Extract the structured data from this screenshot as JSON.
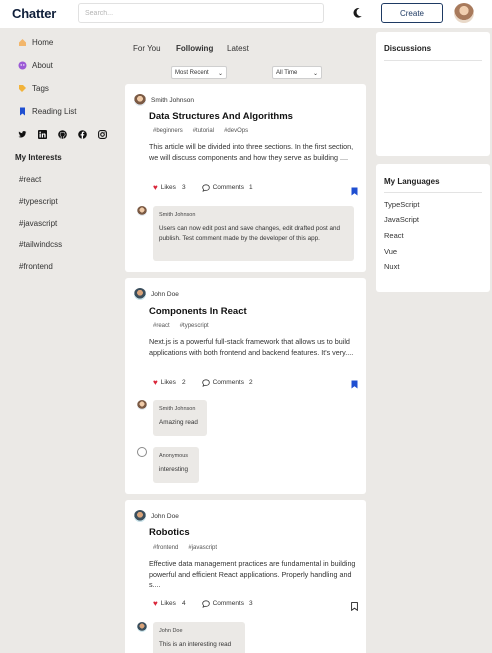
{
  "app": {
    "logo": "Chatter"
  },
  "header": {
    "search_placeholder": "Search...",
    "create_label": "Create",
    "theme_icon": "moon-icon"
  },
  "sidebar": {
    "nav": [
      {
        "label": "Home",
        "icon": "home-icon"
      },
      {
        "label": "About",
        "icon": "about-icon"
      },
      {
        "label": "Tags",
        "icon": "tag-icon"
      },
      {
        "label": "Reading List",
        "icon": "bookmark-icon"
      }
    ],
    "socials": [
      "twitter-icon",
      "linkedin-icon",
      "github-icon",
      "facebook-icon",
      "instagram-icon"
    ],
    "interests_title": "My Interests",
    "interests": [
      "#react",
      "#typescript",
      "#javascript",
      "#tailwindcss",
      "#frontend"
    ]
  },
  "feed": {
    "tabs": [
      {
        "label": "For You"
      },
      {
        "label": "Following",
        "active": true
      },
      {
        "label": "Latest"
      }
    ],
    "sort_value": "Most Recent",
    "time_value": "All Time",
    "posts": [
      {
        "author": "Smith Johnson",
        "title": "Data Structures And Algorithms",
        "tags": [
          "#beginners",
          "#tutorial",
          "#devOps"
        ],
        "excerpt": "This article will be divided into three sections. In the first section, we will discuss components and how they serve as building ....",
        "likes_label": "Likes",
        "likes": "3",
        "comments_label": "Comments",
        "comments": "1",
        "bookmarked": true,
        "comment_list": [
          {
            "name": "Smith Johnson",
            "text": "Users can now edit post and save changes, edit drafted post and publish. Test comment made by the developer of this app."
          }
        ]
      },
      {
        "author": "John Doe",
        "title": "Components In React",
        "tags": [
          "#react",
          "#typescript"
        ],
        "excerpt": "Next.js is a powerful full-stack framework that allows us to build applications with both frontend and backend features. It's very....",
        "likes_label": "Likes",
        "likes": "2",
        "comments_label": "Comments",
        "comments": "2",
        "bookmarked": true,
        "comment_list": [
          {
            "name": "Smith Johnson",
            "text": "Amazing read"
          },
          {
            "name": "Anonymous",
            "text": "interesting"
          }
        ]
      },
      {
        "author": "John Doe",
        "title": "Robotics",
        "tags": [
          "#frontend",
          "#javascript"
        ],
        "excerpt": "Effective data management practices are fundamental in building powerful and efficient React applications. Properly handling and s....",
        "likes_label": "Likes",
        "likes": "4",
        "comments_label": "Comments",
        "comments": "3",
        "bookmarked": false,
        "comment_list": [
          {
            "name": "John Doe",
            "text": "This is an interesting read"
          }
        ]
      }
    ]
  },
  "right": {
    "discussions_title": "Discussions",
    "languages_title": "My Languages",
    "languages": [
      "TypeScript",
      "JavaScript",
      "React",
      "Vue",
      "Nuxt"
    ]
  },
  "colors": {
    "heart": "#d9263a",
    "bookmark_filled": "#1f4fd1",
    "brand": "#1e3a63"
  }
}
